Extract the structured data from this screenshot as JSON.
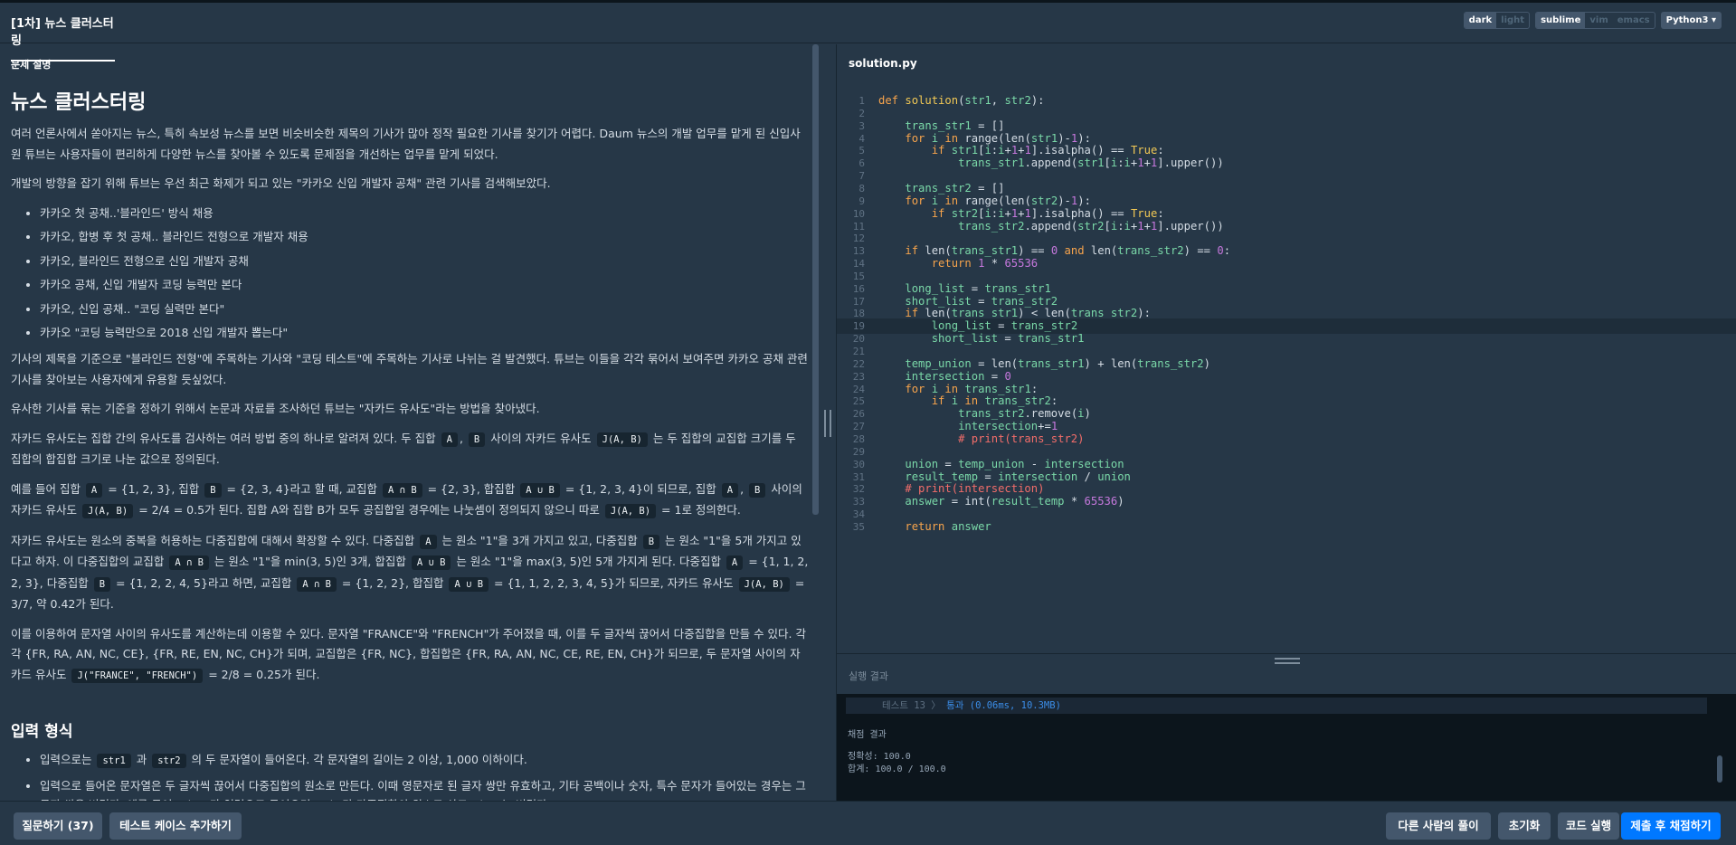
{
  "header": {
    "title": "[1차] 뉴스 클러스터링",
    "theme": {
      "dark": "dark",
      "light": "light"
    },
    "keymap": {
      "sublime": "sublime",
      "vim": "vim",
      "emacs": "emacs"
    },
    "language": "Python3 ▾"
  },
  "problem": {
    "section_label": "문제 설명",
    "title": "뉴스 클러스터링",
    "p1": "여러 언론사에서 쏟아지는 뉴스, 특히 속보성 뉴스를 보면 비슷비슷한 제목의 기사가 많아 정작 필요한 기사를 찾기가 어렵다. Daum 뉴스의 개발 업무를 맡게 된 신입사원 튜브는 사용자들이 편리하게 다양한 뉴스를 찾아볼 수 있도록 문제점을 개선하는 업무를 맡게 되었다.",
    "p2": "개발의 방향을 잡기 위해 튜브는 우선 최근 화제가 되고 있는 \"카카오 신입 개발자 공채\" 관련 기사를 검색해보았다.",
    "headlines": [
      "카카오 첫 공채..'블라인드' 방식 채용",
      "카카오, 합병 후 첫 공채.. 블라인드 전형으로 개발자 채용",
      "카카오, 블라인드 전형으로 신입 개발자 공채",
      "카카오 공채, 신입 개발자 코딩 능력만 본다",
      "카카오, 신입 공채.. \"코딩 실력만 본다\"",
      "카카오 \"코딩 능력만으로 2018 신입 개발자 뽑는다\""
    ],
    "p3": "기사의 제목을 기준으로 \"블라인드 전형\"에 주목하는 기사와 \"코딩 테스트\"에 주목하는 기사로 나뉘는 걸 발견했다. 튜브는 이들을 각각 묶어서 보여주면 카카오 공채 관련 기사를 찾아보는 사용자에게 유용할 듯싶었다.",
    "p4": "유사한 기사를 묶는 기준을 정하기 위해서 논문과 자료를 조사하던 튜브는 \"자카드 유사도\"라는 방법을 찾아냈다.",
    "p5": {
      "t1": "자카드 유사도는 집합 간의 유사도를 검사하는 여러 방법 중의 하나로 알려져 있다. 두 집합 ",
      "c1": "A",
      "t2": ", ",
      "c2": "B",
      "t3": " 사이의 자카드 유사도 ",
      "c3": "J(A, B)",
      "t4": " 는 두 집합의 교집합 크기를 두 집합의 합집합 크기로 나눈 값으로 정의된다."
    },
    "p6": {
      "t1": "예를 들어 집합 ",
      "c1": "A",
      "t2": " = {1, 2, 3}, 집합 ",
      "c2": "B",
      "t3": " = {2, 3, 4}라고 할 때, 교집합 ",
      "c3": "A ∩ B",
      "t4": " = {2, 3}, 합집합 ",
      "c4": "A ∪ B",
      "t5": " = {1, 2, 3, 4}이 되므로, 집합 ",
      "c5": "A",
      "t6": ", ",
      "c6": "B",
      "t7": " 사이의 자카드 유사도 ",
      "c7": "J(A, B)",
      "t8": " = 2/4 = 0.5가 된다. 집합 A와 집합 B가 모두 공집합일 경우에는 나눗셈이 정의되지 않으니 따로 ",
      "c8": "J(A, B)",
      "t9": " = 1로 정의한다."
    },
    "p7": {
      "t1": "자카드 유사도는 원소의 중복을 허용하는 다중집합에 대해서 확장할 수 있다. 다중집합 ",
      "c1": "A",
      "t2": " 는 원소 \"1\"을 3개 가지고 있고, 다중집합 ",
      "c2": "B",
      "t3": " 는 원소 \"1\"을 5개 가지고 있다고 하자. 이 다중집합의 교집합 ",
      "c3": "A ∩ B",
      "t4": " 는 원소 \"1\"을 min(3, 5)인 3개, 합집합 ",
      "c4": "A ∪ B",
      "t5": " 는 원소 \"1\"을 max(3, 5)인 5개 가지게 된다. 다중집합 ",
      "c5": "A",
      "t6": " = {1, 1, 2, 2, 3}, 다중집합 ",
      "c6": "B",
      "t7": " = {1, 2, 2, 4, 5}라고 하면, 교집합 ",
      "c7": "A ∩ B",
      "t8": " = {1, 2, 2}, 합집합 ",
      "c8": "A ∪ B",
      "t9": " = {1, 1, 2, 2, 3, 4, 5}가 되므로, 자카드 유사도 ",
      "c9": "J(A, B)",
      "t10": " = 3/7, 약 0.42가 된다."
    },
    "p8": {
      "t1": "이를 이용하여 문자열 사이의 유사도를 계산하는데 이용할 수 있다. 문자열 \"FRANCE\"와 \"FRENCH\"가 주어졌을 때, 이를 두 글자씩 끊어서 다중집합을 만들 수 있다. 각각 {FR, RA, AN, NC, CE}, {FR, RE, EN, NC, CH}가 되며, 교집합은 {FR, NC}, 합집합은 {FR, RA, AN, NC, CE, RE, EN, CH}가 되므로, 두 문자열 사이의 자카드 유사도 ",
      "c1": "J(\"FRANCE\", \"FRENCH\")",
      "t2": " = 2/8 = 0.25가 된다."
    },
    "input_title": "입력 형식",
    "input_1": {
      "t1": "입력으로는 ",
      "c1": "str1",
      "t2": " 과 ",
      "c2": "str2",
      "t3": " 의 두 문자열이 들어온다. 각 문자열의 길이는 2 이상, 1,000 이하이다."
    },
    "input_2": "입력으로 들어온 문자열은 두 글자씩 끊어서 다중집합의 원소로 만든다. 이때 영문자로 된 글자 쌍만 유효하고, 기타 공백이나 숫자, 특수 문자가 들어있는 경우는 그 글자 쌍을 버린다. 예를 들어 \"ab+\"가 입력으로 들어오면, \"ab\"만 다중집합의 원소로 삼고, \"b+\"는 버린다."
  },
  "editor": {
    "filename": "solution.py",
    "cursor_line": 19,
    "lines": [
      "def solution(str1, str2):",
      "",
      "    trans_str1 = []",
      "    for i in range(len(str1)-1):",
      "        if str1[i:i+1+1].isalpha() == True:",
      "            trans_str1.append(str1[i:i+1+1].upper())",
      "",
      "    trans_str2 = []",
      "    for i in range(len(str2)-1):",
      "        if str2[i:i+1+1].isalpha() == True:",
      "            trans_str2.append(str2[i:i+1+1].upper())",
      "",
      "    if len(trans_str1) == 0 and len(trans_str2) == 0:",
      "        return 1 * 65536",
      "",
      "    long_list = trans_str1",
      "    short_list = trans_str2",
      "    if len(trans_str1) < len(trans_str2):",
      "        long_list = trans_str2",
      "        short_list = trans_str1",
      "",
      "    temp_union = len(trans_str1) + len(trans_str2)",
      "    intersection = 0",
      "    for i in trans_str1:",
      "        if i in trans_str2:",
      "            trans_str2.remove(i)",
      "            intersection+=1",
      "            # print(trans_str2)",
      "",
      "    union = temp_union - intersection",
      "    result_temp = intersection / union",
      "    # print(intersection)",
      "    answer = int(result_temp * 65536)",
      "",
      "    return answer"
    ]
  },
  "result": {
    "title": "실행 결과",
    "test_label": "테스트 13 〉",
    "test_status": "통과 (0.06ms, 10.3MB)",
    "final_title": "채점 결과",
    "accuracy": "정확성: 100.0",
    "total": "합계: 100.0 / 100.0"
  },
  "footer": {
    "question": "질문하기 (37)",
    "add_testcase": "테스트 케이스 추가하기",
    "others": "다른 사람의 풀이",
    "reset": "초기화",
    "run": "코드 실행",
    "submit": "제출 후 채점하기"
  }
}
